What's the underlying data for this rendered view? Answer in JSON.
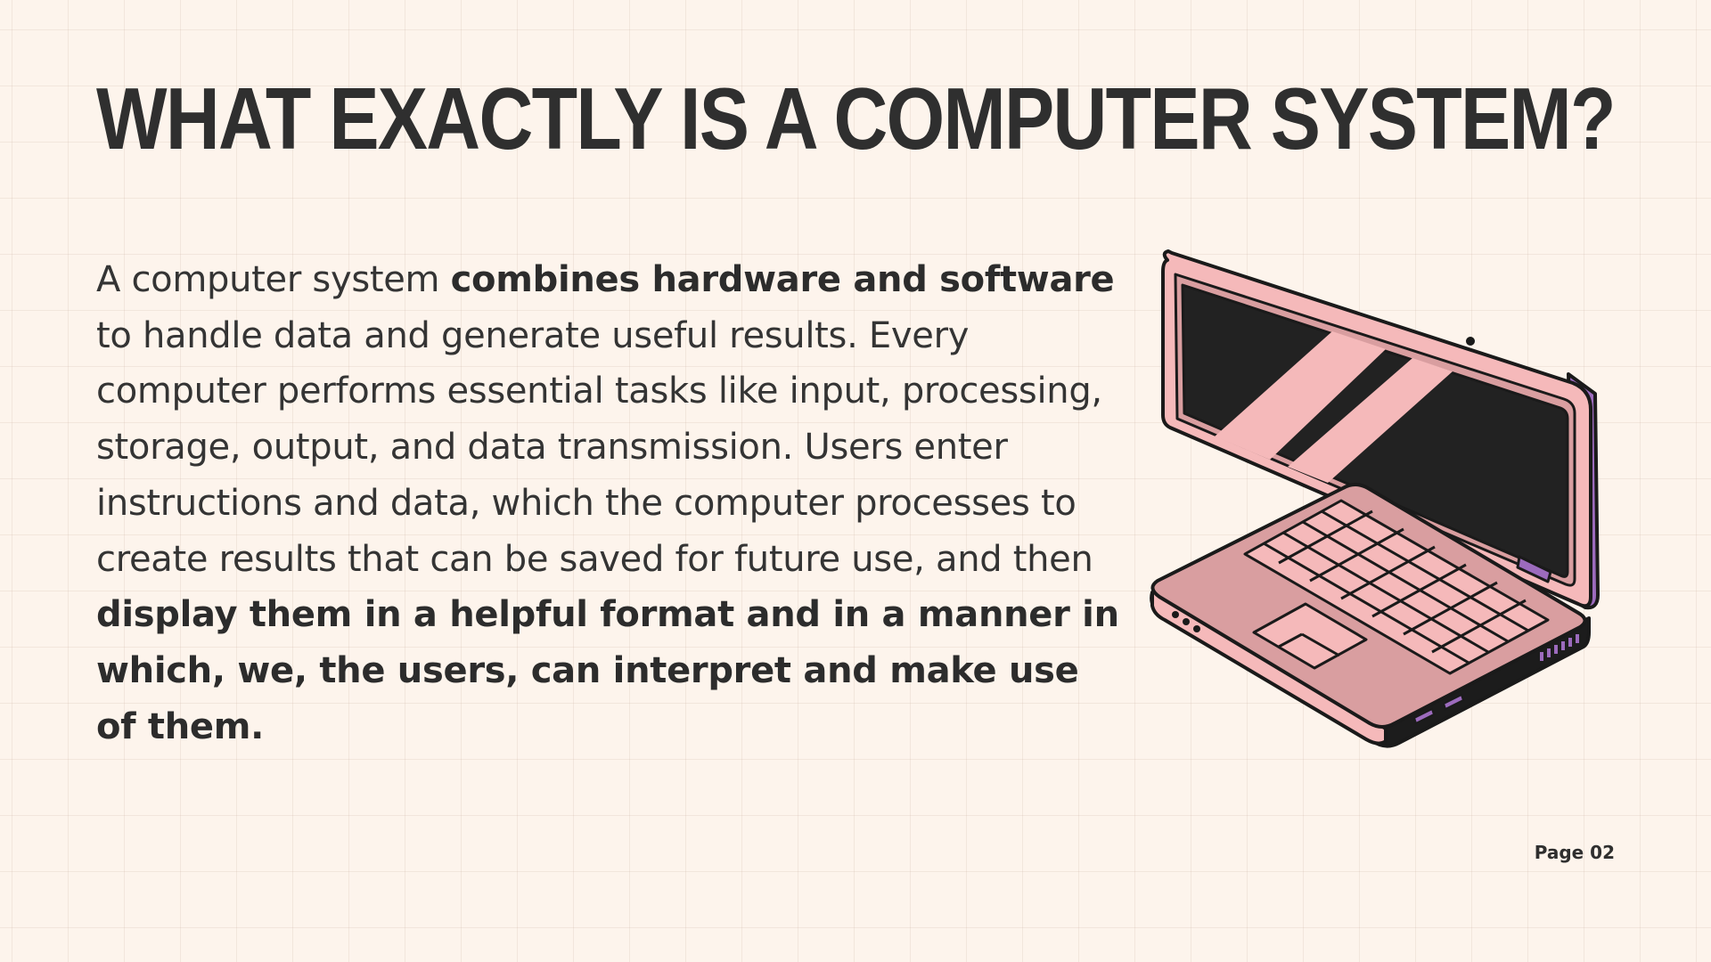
{
  "slide": {
    "title": "WHAT EXACTLY IS A COMPUTER SYSTEM?",
    "paragraph": {
      "seg1": "A computer system ",
      "seg2_bold": "combines hardware and software",
      "seg3": " to handle data and generate useful results. Every computer performs essential tasks like input, processing, storage, output, and data transmission. Users enter instructions and data, which the computer processes to create results that can be saved for future use, and then ",
      "seg4_bold": "display them in a helpful format and in a manner in which, we, the users, can interpret and make use of them."
    },
    "page_label": "Page 02"
  },
  "illustration": {
    "icon": "laptop-icon",
    "colors": {
      "body": "#d99ea0",
      "screen_frame": "#f5b9ba",
      "screen": "#222222",
      "accent": "#9c6bbd",
      "outline": "#1a1a1a"
    }
  },
  "colors": {
    "background": "#fdf4ec",
    "text": "#2f2f2f"
  }
}
